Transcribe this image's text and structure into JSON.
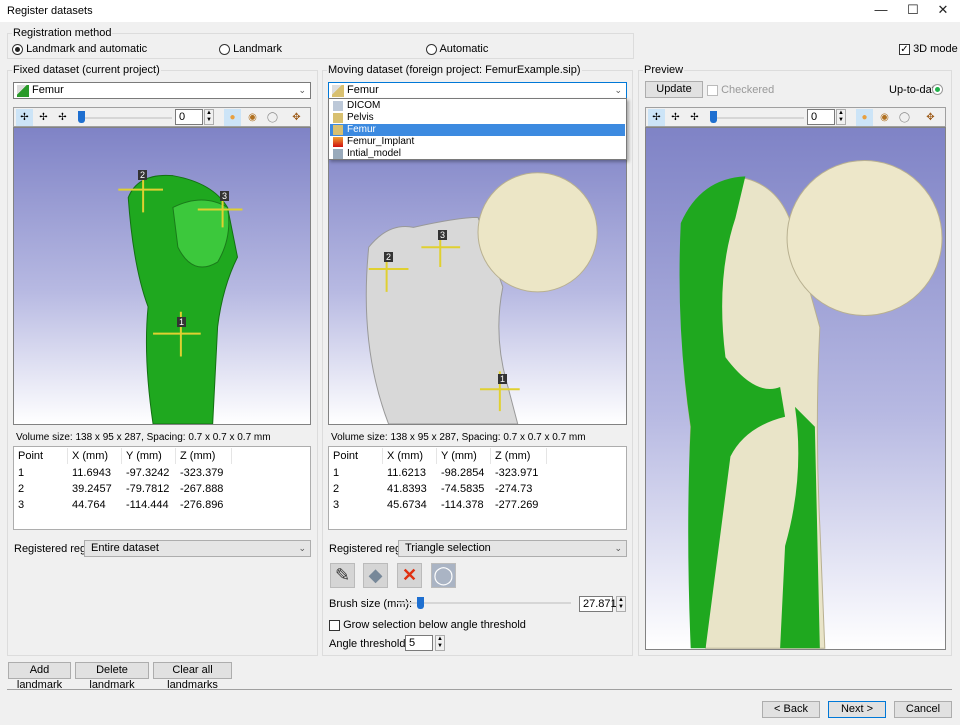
{
  "window": {
    "title": "Register datasets",
    "controls": [
      "minimize-icon",
      "maximize-icon",
      "close-icon"
    ]
  },
  "registration_method": {
    "label": "Registration method",
    "options": [
      "Landmark and automatic",
      "Landmark",
      "Automatic"
    ],
    "selected": "Landmark and automatic",
    "mode_3d_label": "3D mode",
    "mode_3d_checked": true
  },
  "fixed": {
    "title": "Fixed dataset (current project)",
    "dataset": "Femur",
    "toolbar_value": "0",
    "volume_info": "Volume size: 138 x 95 x 287, Spacing: 0.7 x 0.7 x 0.7 mm",
    "columns": [
      "Point",
      "X (mm)",
      "Y (mm)",
      "Z (mm)"
    ],
    "rows": [
      [
        "1",
        "11.6943",
        "-97.3242",
        "-323.379"
      ],
      [
        "2",
        "39.2457",
        "-79.7812",
        "-267.888"
      ],
      [
        "3",
        "44.764",
        "-114.444",
        "-276.896"
      ]
    ],
    "region_label": "Registered region:",
    "region_value": "Entire dataset",
    "landmarks": [
      "1",
      "2",
      "3"
    ]
  },
  "moving": {
    "title": "Moving dataset (foreign project: FemurExample.sip)",
    "dataset": "Femur",
    "dropdown_items": [
      "DICOM",
      "Pelvis",
      "Femur",
      "Femur_Implant",
      "Intial_model"
    ],
    "dropdown_selected": "Femur",
    "volume_info": "Volume size: 138 x 95 x 287, Spacing: 0.7 x 0.7 x 0.7 mm",
    "columns": [
      "Point",
      "X (mm)",
      "Y (mm)",
      "Z (mm)"
    ],
    "rows": [
      [
        "1",
        "11.6213",
        "-98.2854",
        "-323.971"
      ],
      [
        "2",
        "41.8393",
        "-74.5835",
        "-274.73"
      ],
      [
        "3",
        "45.6734",
        "-114.378",
        "-277.269"
      ]
    ],
    "region_label": "Registered region:",
    "region_value": "Triangle selection",
    "tools": [
      "brush-icon",
      "eraser-icon",
      "clear-icon",
      "invert-icon"
    ],
    "brush_label": "Brush size (mm):",
    "brush_value": "27.8715",
    "brush_fraction": 0.12,
    "grow_label": "Grow selection below angle threshold",
    "grow_checked": false,
    "angle_label": "Angle threshold (°):",
    "angle_value": "5",
    "landmarks": [
      "1",
      "2",
      "3"
    ]
  },
  "preview": {
    "title": "Preview",
    "update_label": "Update",
    "checkered_label": "Checkered",
    "checkered_checked": false,
    "status_label": "Up-to-date",
    "status_color": "#22b14c",
    "toolbar_value": "0"
  },
  "footer": {
    "add": "Add landmark",
    "delete": "Delete landmark",
    "clear": "Clear all landmarks",
    "back": "< Back",
    "next": "Next >",
    "cancel": "Cancel"
  },
  "colors": {
    "green": "#1fa81f",
    "bone": "#e9e4c8",
    "selection": "#3c8ae0"
  }
}
